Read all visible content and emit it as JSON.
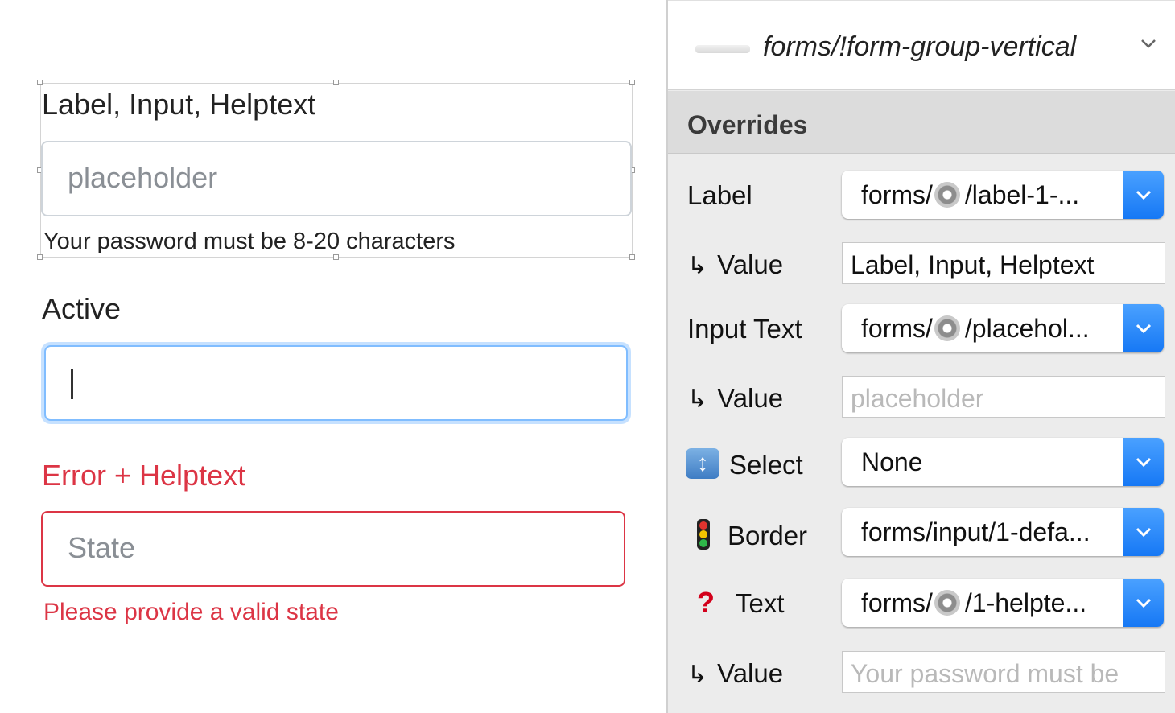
{
  "canvas": {
    "group1": {
      "label": "Label, Input, Helptext",
      "placeholder": "placeholder",
      "helptext": "Your password must be 8-20 characters"
    },
    "group2": {
      "label": "Active"
    },
    "group3": {
      "label": "Error + Helptext",
      "placeholder": "State",
      "error_text": "Please provide a valid state"
    }
  },
  "inspector": {
    "symbol_name": "forms/!form-group-vertical",
    "overrides_title": "Overrides",
    "rows": [
      {
        "label": "Label",
        "type": "combo",
        "prefix": "forms/",
        "suffix": "/label-1-..."
      },
      {
        "label": "Value",
        "type": "field",
        "value": "Label, Input, Helptext",
        "is_placeholder": false
      },
      {
        "label": "Input Text",
        "type": "combo",
        "prefix": "forms/",
        "suffix": "/placehol..."
      },
      {
        "label": "Value",
        "type": "field",
        "value": "placeholder",
        "is_placeholder": true
      },
      {
        "label": "Select",
        "type": "combo",
        "value": "None",
        "icon": "select-arrows-icon"
      },
      {
        "label": "Border",
        "type": "combo",
        "value": "forms/input/1-defa...",
        "icon": "traffic-light-icon"
      },
      {
        "label": "Text",
        "type": "combo",
        "prefix": "forms/",
        "suffix": "/1-helpte...",
        "icon": "question-mark-icon"
      },
      {
        "label": "Value",
        "type": "field",
        "value": "Your password must be",
        "is_placeholder": true
      }
    ]
  },
  "colors": {
    "error": "#dc3545",
    "focus": "#80bdff",
    "dropdown_accent": "#1678f5"
  }
}
